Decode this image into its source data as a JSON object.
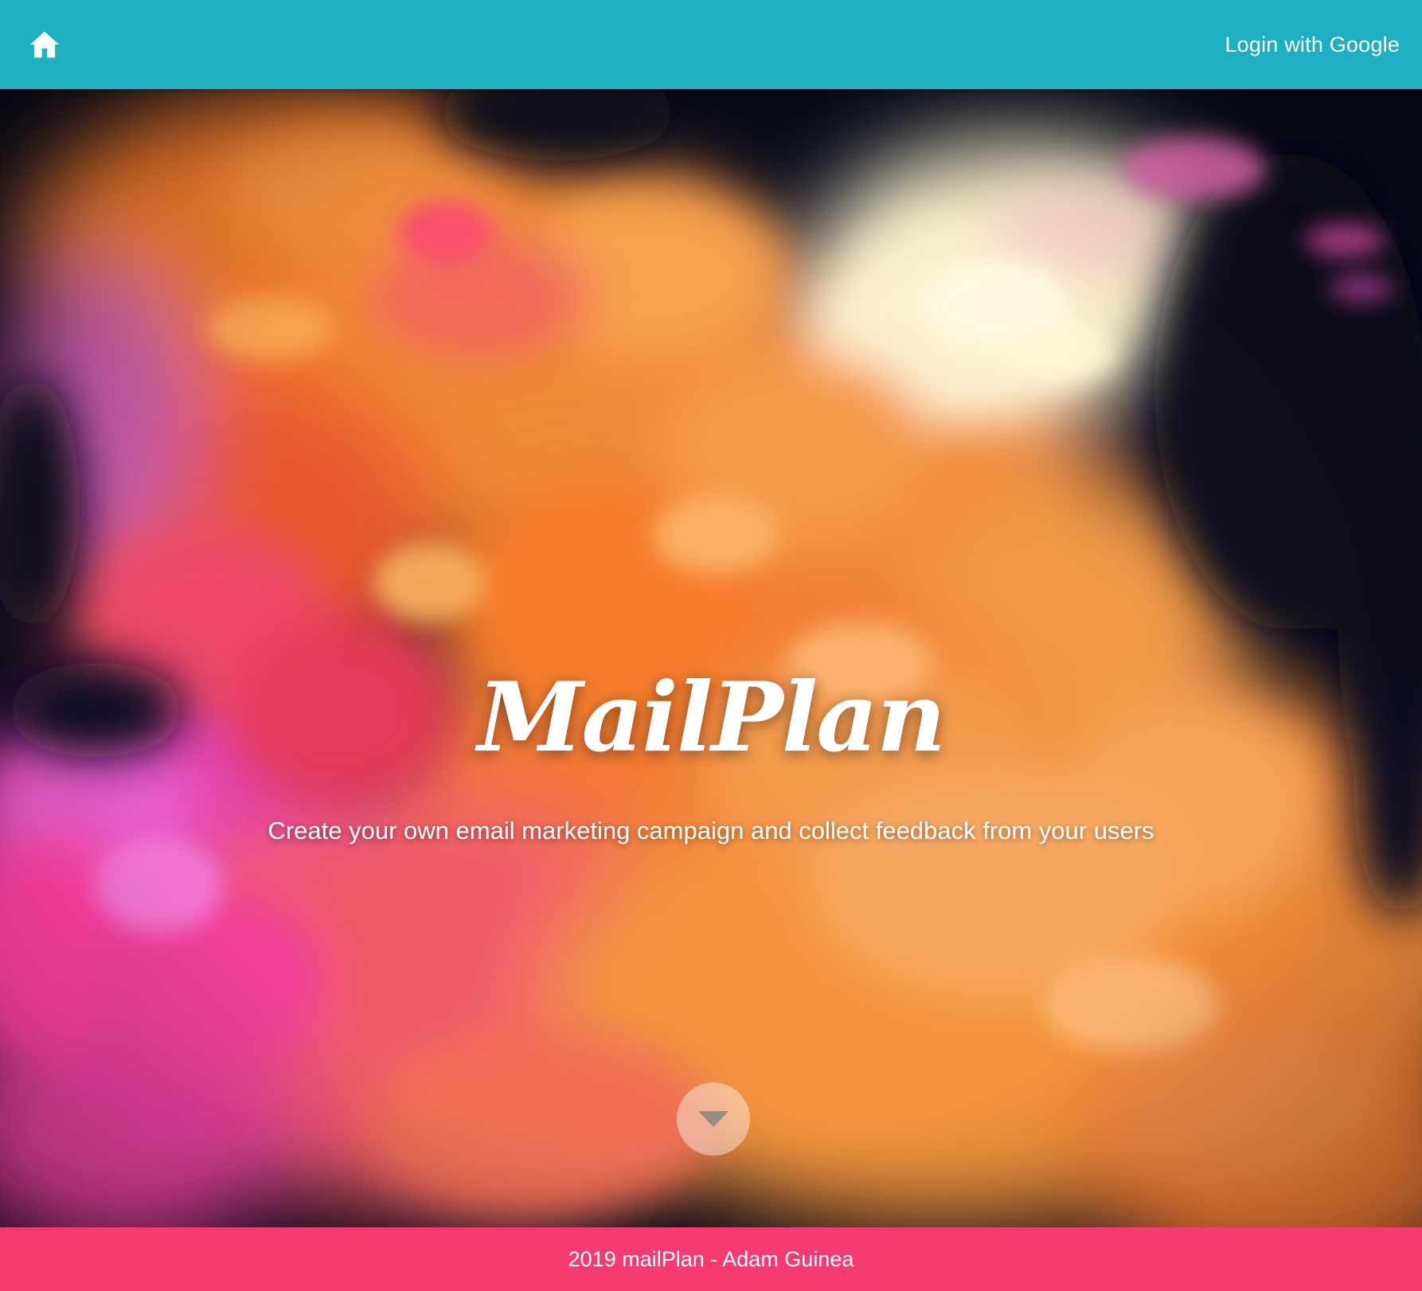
{
  "navbar": {
    "home_icon": "home-icon",
    "login_label": "Login with Google",
    "background_color": "#1eb0c2"
  },
  "hero": {
    "title": "MailPlan",
    "tagline": "Create your own email marketing campaign and collect feedback from your users",
    "scroll_icon": "caret-down-icon"
  },
  "footer": {
    "text": "2019 mailPlan - Adam Guinea",
    "background_color": "#f53b72"
  }
}
